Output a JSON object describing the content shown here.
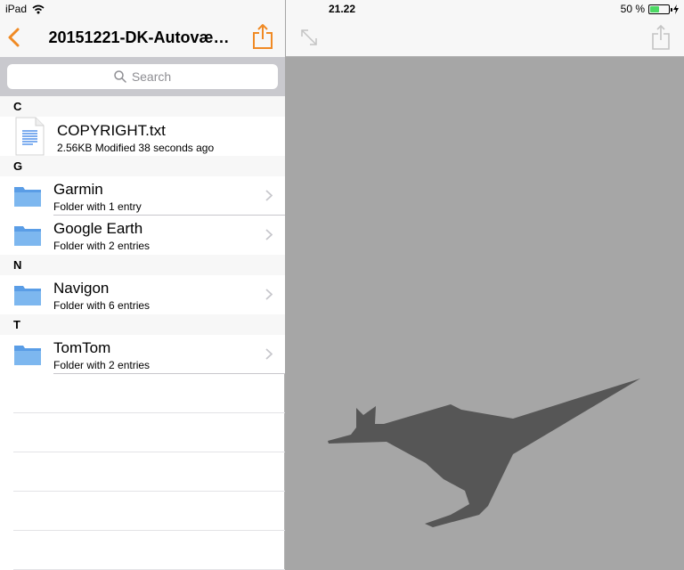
{
  "status": {
    "device": "iPad",
    "time": "21.22",
    "battery": "50 %",
    "battery_level": 0.5
  },
  "nav": {
    "title": "20151221-DK-Autovæ…"
  },
  "search": {
    "placeholder": "Search"
  },
  "sections": [
    {
      "header": "C",
      "items": [
        {
          "title": "COPYRIGHT.txt",
          "subtitle": "2.56KB  Modified 38 seconds ago",
          "type": "file"
        }
      ]
    },
    {
      "header": "G",
      "items": [
        {
          "title": "Garmin",
          "subtitle": "Folder with 1 entry",
          "type": "folder"
        },
        {
          "title": "Google Earth",
          "subtitle": "Folder with 2 entries",
          "type": "folder"
        }
      ]
    },
    {
      "header": "N",
      "items": [
        {
          "title": "Navigon",
          "subtitle": "Folder with 6 entries",
          "type": "folder"
        }
      ]
    },
    {
      "header": "T",
      "items": [
        {
          "title": "TomTom",
          "subtitle": "Folder with 2 entries",
          "type": "folder"
        }
      ]
    }
  ],
  "colors": {
    "accent": "#f08a24",
    "folder": "#6aa8e8",
    "battery": "#4cd964",
    "viewer_bg": "#a6a6a6",
    "logo": "#565656"
  },
  "icons": {
    "back": "chevron-left-icon",
    "share": "share-icon",
    "expand": "expand-arrows-icon",
    "search": "search-icon",
    "logo": "kangaroo-logo"
  }
}
